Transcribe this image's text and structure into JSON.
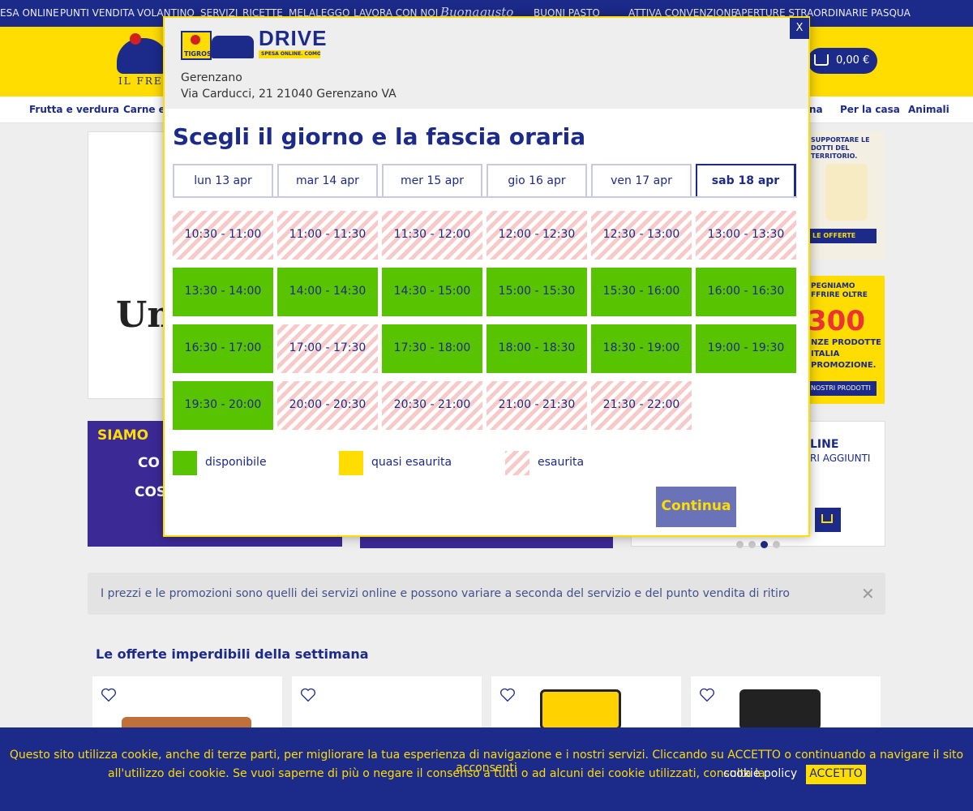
{
  "topnav": {
    "items": [
      "ESA ONLINE",
      "PUNTI VENDITA",
      "VOLANTINO",
      "SERVIZI",
      "RICETTE",
      "MELALEGGO",
      "LAVORA CON NOI",
      "Buonagusto",
      "BUONI PASTO",
      "ATTIVA CONVENZIONE",
      "APERTURE STRAORDINARIE PASQUA"
    ]
  },
  "header": {
    "logo_text": "IL FRES",
    "cart_amount": "0,00 €"
  },
  "categories": [
    "Frutta e verdura",
    "Carne e",
    "na",
    "Per la casa",
    "Animali"
  ],
  "background": {
    "hero_text": "Un",
    "promo1_text": "SUPPORTARE LE\nDOTTI DEL TERRITORIO.",
    "promo1_badge": "LE OFFERTE",
    "promo2_text": "PEGNIAMO\nFFRIRE OLTRE",
    "promo2_num": "300",
    "promo2_text2": "NZE PRODOTTE\nITALIA\nPROMOZIONE.",
    "promo2_badge": "NOSTRI PRODOTTI",
    "banner_a_title": "SIAMO",
    "banner_a_line1": "CO",
    "banner_a_line2": "COS",
    "banner_c_line1": "LINE",
    "banner_c_line2": "RI AGGIUNTI",
    "notice": "I prezzi e le promozioni sono quelli dei servizi online e possono variare a seconda del servizio e del punto vendita di ritiro",
    "offers_title": "Le offerte imperdibili della settimana"
  },
  "cookie": {
    "line1": "Questo sito utilizza cookie, anche di terze parti, per migliorare la tua esperienza di navigazione e i nostri servizi. Cliccando su ACCETTO o continuando a navigare il sito acconsenti",
    "line2": "all'utilizzo dei cookie. Se vuoi saperne di più o negare il consenso a tutti o ad alcuni dei cookie utilizzati, consulta la",
    "link": "cookie policy",
    "accept": "ACCETTO"
  },
  "modal": {
    "close_label": "X",
    "drive_word": "DRIVE",
    "drive_tagline": "SPESA ONLINE. COMODA E VELOCE",
    "brand": "TIGROS",
    "store_name": "Gerenzano",
    "store_address": "Via Carducci, 21 21040 Gerenzano VA",
    "title": "Scegli il giorno e la fascia oraria",
    "days": [
      "lun 13 apr",
      "mar 14 apr",
      "mer 15 apr",
      "gio 16 apr",
      "ven 17 apr",
      "sab 18 apr"
    ],
    "active_day": 5,
    "slots": [
      {
        "label": "10:30 - 11:00",
        "status": "esaurita"
      },
      {
        "label": "11:00 - 11:30",
        "status": "esaurita"
      },
      {
        "label": "11:30 - 12:00",
        "status": "esaurita"
      },
      {
        "label": "12:00 - 12:30",
        "status": "esaurita"
      },
      {
        "label": "12:30 - 13:00",
        "status": "esaurita"
      },
      {
        "label": "13:00 - 13:30",
        "status": "esaurita"
      },
      {
        "label": "13:30 - 14:00",
        "status": "disponibile"
      },
      {
        "label": "14:00 - 14:30",
        "status": "disponibile"
      },
      {
        "label": "14:30 - 15:00",
        "status": "disponibile"
      },
      {
        "label": "15:00 - 15:30",
        "status": "disponibile"
      },
      {
        "label": "15:30 - 16:00",
        "status": "disponibile"
      },
      {
        "label": "16:00 - 16:30",
        "status": "disponibile"
      },
      {
        "label": "16:30 - 17:00",
        "status": "disponibile"
      },
      {
        "label": "17:00 - 17:30",
        "status": "esaurita"
      },
      {
        "label": "17:30 - 18:00",
        "status": "disponibile"
      },
      {
        "label": "18:00 - 18:30",
        "status": "disponibile"
      },
      {
        "label": "18:30 - 19:00",
        "status": "disponibile"
      },
      {
        "label": "19:00 - 19:30",
        "status": "disponibile"
      },
      {
        "label": "19:30 - 20:00",
        "status": "disponibile"
      },
      {
        "label": "20:00 - 20:30",
        "status": "esaurita"
      },
      {
        "label": "20:30 - 21:00",
        "status": "esaurita"
      },
      {
        "label": "21:00 - 21:30",
        "status": "esaurita"
      },
      {
        "label": "21:30 - 22:00",
        "status": "esaurita"
      }
    ],
    "legend": {
      "available": "disponibile",
      "almost": "quasi esaurita",
      "soldout": "esaurita"
    },
    "continue_label": "Continua"
  },
  "colors": {
    "brand_blue": "#1c2a8a",
    "brand_yellow": "#ffdd00",
    "available_green": "#58c300",
    "soldout_pink": "#f7c9c9"
  }
}
